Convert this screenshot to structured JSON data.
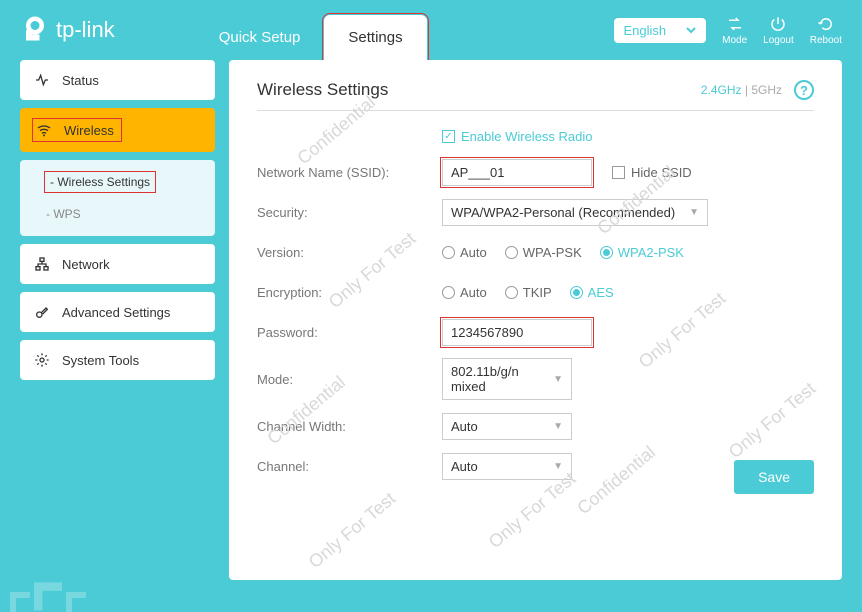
{
  "brand": "tp-link",
  "tabs": {
    "quick": "Quick Setup",
    "settings": "Settings"
  },
  "lang": "English",
  "hdr": {
    "mode": "Mode",
    "logout": "Logout",
    "reboot": "Reboot"
  },
  "sidebar": {
    "status": "Status",
    "wireless": "Wireless",
    "network": "Network",
    "advanced": "Advanced Settings",
    "tools": "System Tools",
    "sub": {
      "ws": "Wireless Settings",
      "wps": "WPS"
    }
  },
  "page": {
    "title": "Wireless Settings",
    "band24": "2.4GHz",
    "sep": " | ",
    "band5": "5GHz",
    "enable": "Enable Wireless Radio",
    "ssid_label": "Network Name (SSID):",
    "ssid_value": "AP___01",
    "hide": "Hide SSID",
    "sec_label": "Security:",
    "sec_value": "WPA/WPA2-Personal (Recommended)",
    "ver_label": "Version:",
    "ver_opts": {
      "auto": "Auto",
      "wpa": "WPA-PSK",
      "wpa2": "WPA2-PSK"
    },
    "enc_label": "Encryption:",
    "enc_opts": {
      "auto": "Auto",
      "tkip": "TKIP",
      "aes": "AES"
    },
    "pwd_label": "Password:",
    "pwd_value": "1234567890",
    "mode_label": "Mode:",
    "mode_value": "802.11b/g/n mixed",
    "cw_label": "Channel Width:",
    "cw_value": "Auto",
    "ch_label": "Channel:",
    "ch_value": "Auto",
    "save": "Save"
  },
  "watermark": {
    "a": "Confidential",
    "b": "Only For Test"
  }
}
